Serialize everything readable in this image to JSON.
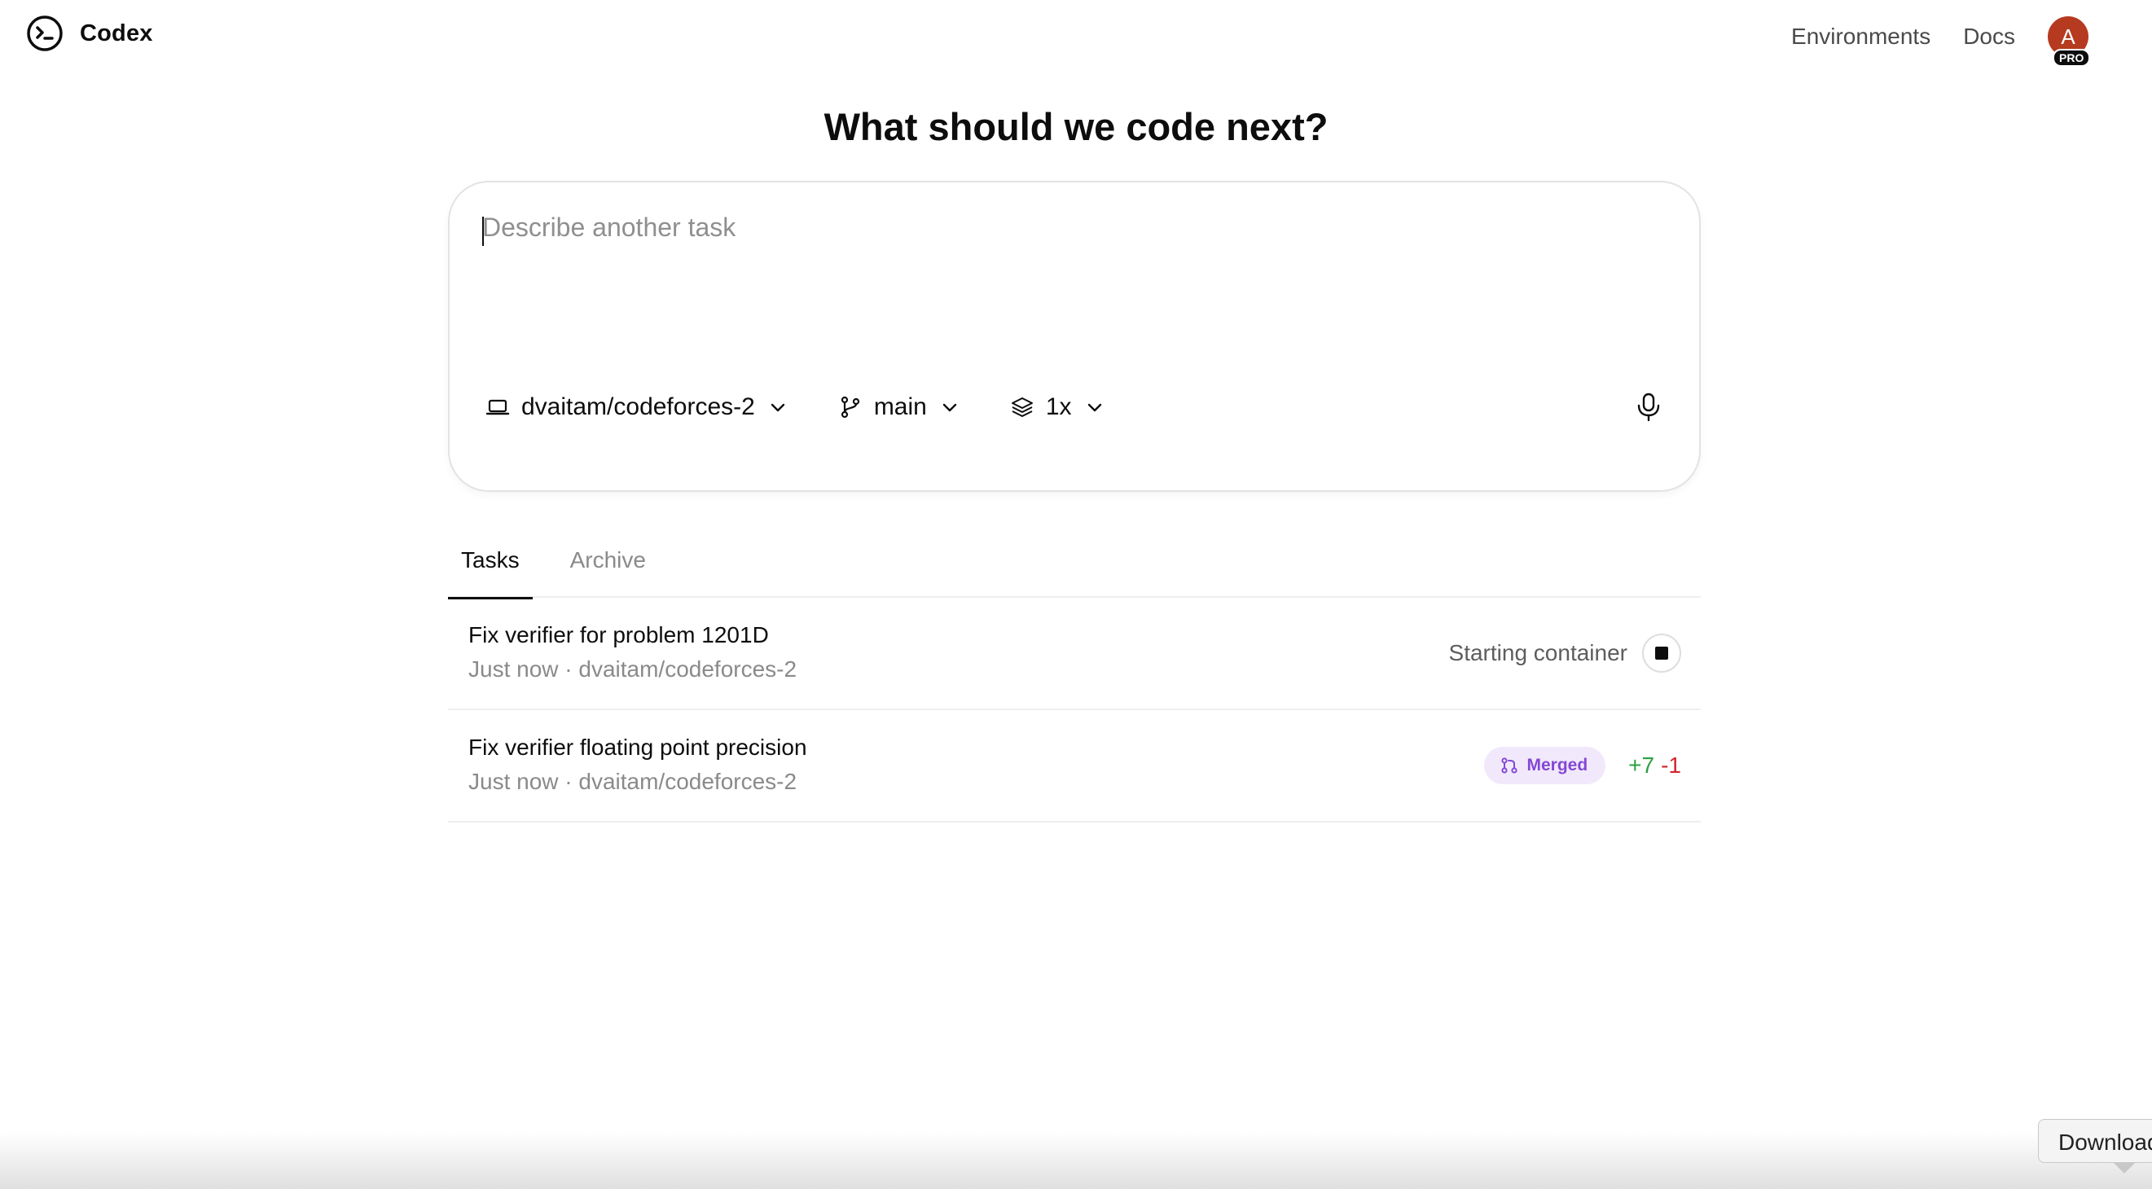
{
  "header": {
    "app_name": "Codex",
    "nav": {
      "environments": "Environments",
      "docs": "Docs"
    },
    "avatar": {
      "initial": "A",
      "badge": "PRO",
      "color": "#b63a1f"
    }
  },
  "main": {
    "title": "What should we code next?"
  },
  "composer": {
    "placeholder": "Describe another task",
    "value": "",
    "repo": {
      "label": "dvaitam/codeforces-2",
      "icon": "laptop-icon"
    },
    "branch": {
      "label": "main",
      "icon": "branch-icon"
    },
    "versions": {
      "label": "1x",
      "icon": "layers-icon"
    },
    "mic_icon": "microphone-icon"
  },
  "tabs": [
    {
      "label": "Tasks",
      "active": true
    },
    {
      "label": "Archive",
      "active": false
    }
  ],
  "tasks": [
    {
      "title": "Fix verifier for problem 1201D",
      "meta": "Just now · dvaitam/codeforces-2",
      "status": "Starting container",
      "action_icon": "stop-icon"
    },
    {
      "title": "Fix verifier floating point precision",
      "meta": "Just now · dvaitam/codeforces-2",
      "badge": "Merged",
      "additions": "+7",
      "deletions": "-1"
    }
  ],
  "download_tooltip": "Download",
  "colors": {
    "merged_text": "#8447d6",
    "merged_bg": "#f1e9fb",
    "additions": "#2ea043",
    "deletions": "#d1242f"
  }
}
